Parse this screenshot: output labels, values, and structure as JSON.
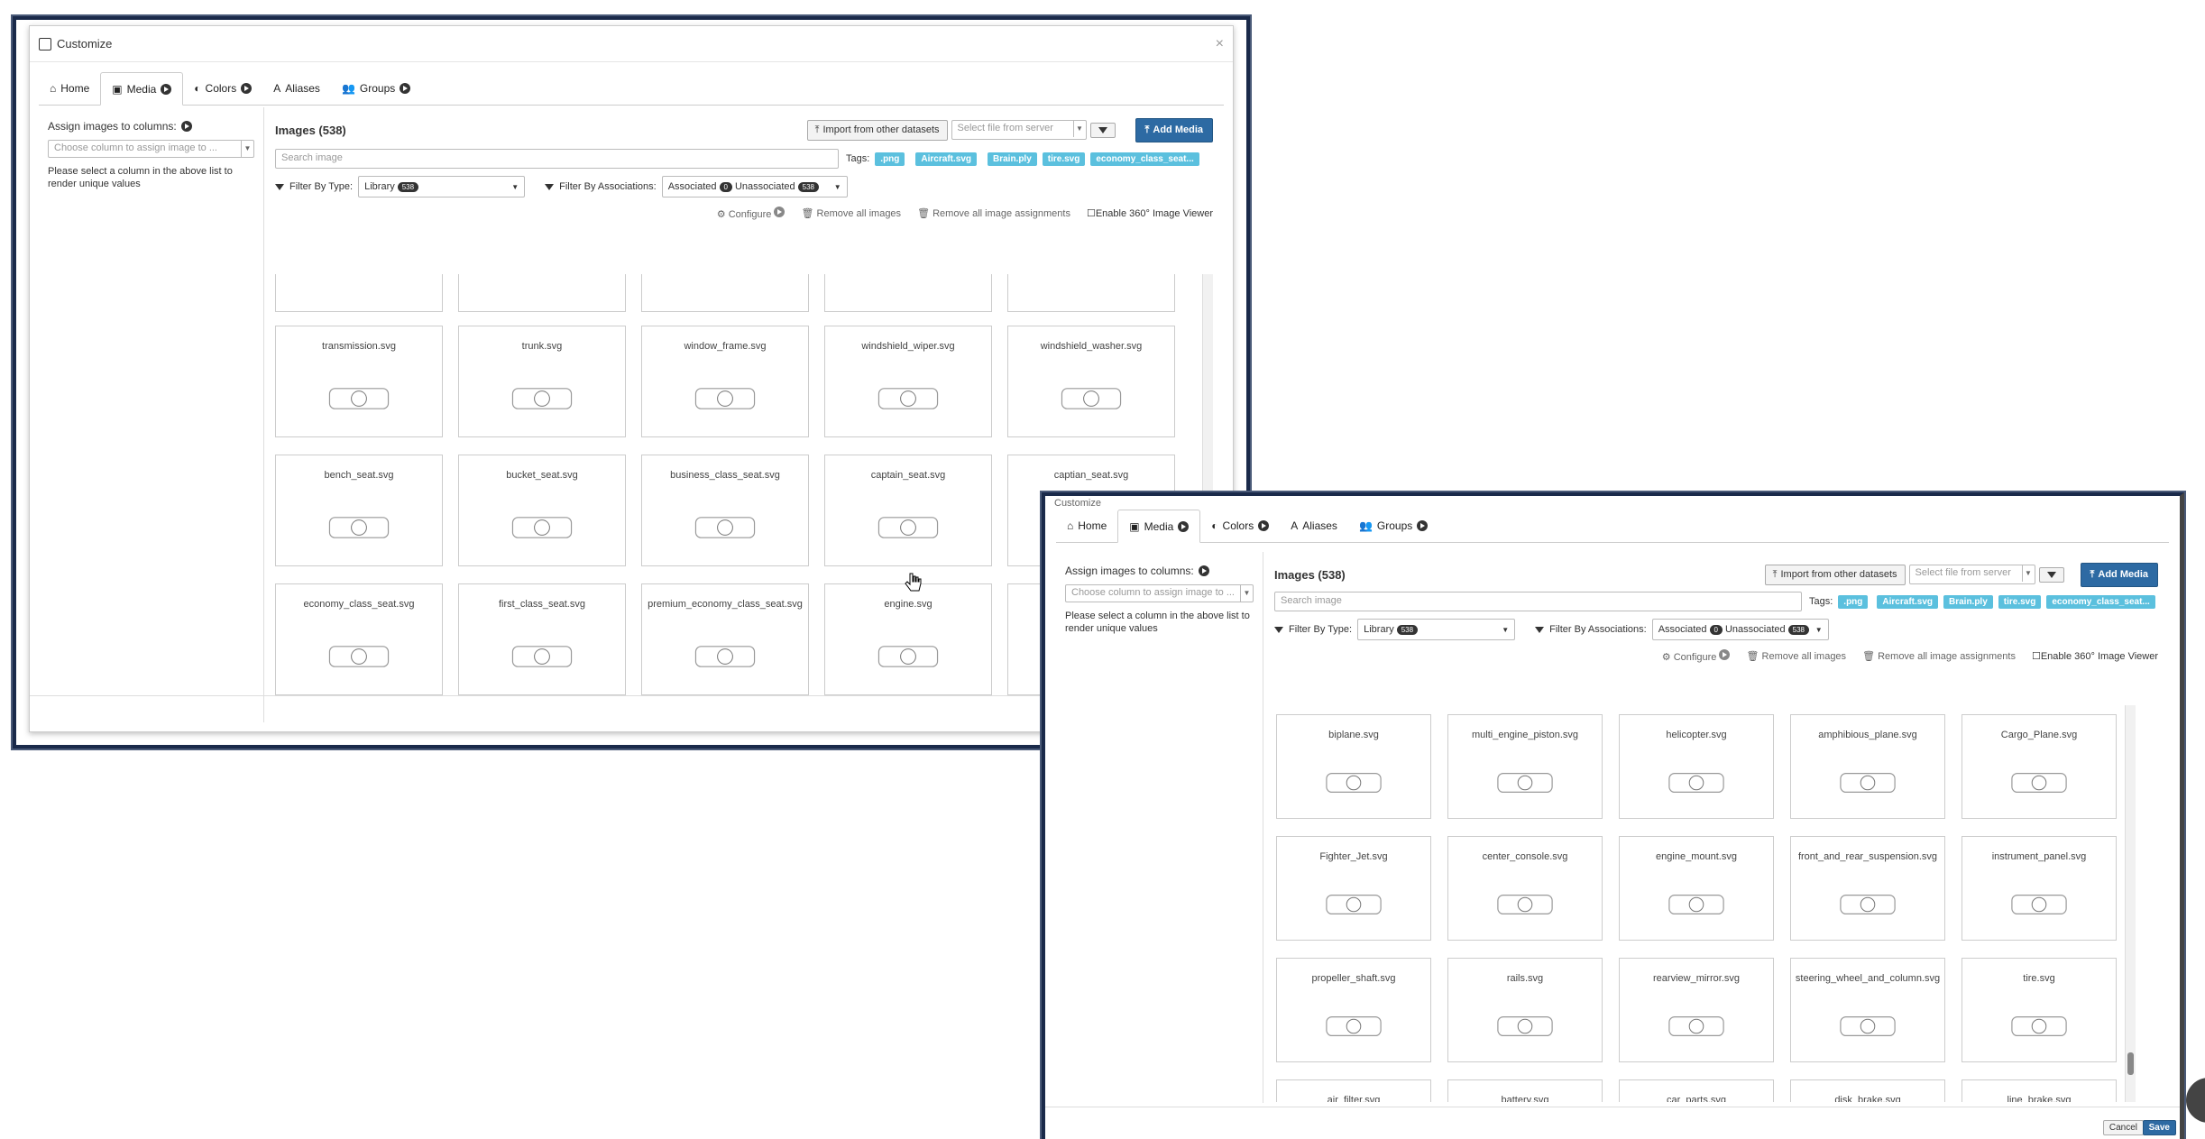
{
  "dialog": {
    "title": "Customize",
    "close": "×"
  },
  "tabs": [
    {
      "label": "Home",
      "icon": "home-icon",
      "dot": false
    },
    {
      "label": "Media",
      "icon": "image-icon",
      "dot": true
    },
    {
      "label": "Colors",
      "icon": "contrast-icon",
      "dot": true
    },
    {
      "label": "Aliases",
      "icon": "font-icon",
      "dot": false
    },
    {
      "label": "Groups",
      "icon": "users-icon",
      "dot": true
    }
  ],
  "left": {
    "assign_label": "Assign images to columns:",
    "column_placeholder": "Choose column to assign image to ...",
    "hint": "Please select a column in the above list to render unique values"
  },
  "media": {
    "images_title": "Images (538)",
    "import_label": "Import from other datasets",
    "server_placeholder": "Select file from server",
    "add_media": "Add Media",
    "search_placeholder": "Search image",
    "tags_label": "Tags:",
    "tags": [
      ".png",
      "Aircraft.svg",
      "Brain.ply",
      "tire.svg",
      "economy_class_seat..."
    ],
    "filter_type_label": "Filter By Type:",
    "filter_type_value": "Library",
    "filter_type_count": "538",
    "filter_assoc_label": "Filter By Associations:",
    "assoc_label": "Associated",
    "assoc_count": "0",
    "unassoc_label": "Unassociated",
    "unassoc_count": "538",
    "configure": "Configure",
    "remove_all": "Remove all images",
    "remove_assign": "Remove all image assignments",
    "enable_360": "Enable 360° Image Viewer"
  },
  "win1_cards": [
    [
      "transmission.svg",
      "trunk.svg",
      "window_frame.svg",
      "windshield_wiper.svg",
      "windshield_washer.svg"
    ],
    [
      "bench_seat.svg",
      "bucket_seat.svg",
      "business_class_seat.svg",
      "captain_seat.svg",
      "captian_seat.svg"
    ],
    [
      "economy_class_seat.svg",
      "first_class_seat.svg",
      "premium_economy_class_seat.svg",
      "engine.svg",
      ""
    ]
  ],
  "win2_cards": [
    [
      "biplane.svg",
      "multi_engine_piston.svg",
      "helicopter.svg",
      "amphibious_plane.svg",
      "Cargo_Plane.svg"
    ],
    [
      "Fighter_Jet.svg",
      "center_console.svg",
      "engine_mount.svg",
      "front_and_rear_suspension.svg",
      "instrument_panel.svg"
    ],
    [
      "propeller_shaft.svg",
      "rails.svg",
      "rearview_mirror.svg",
      "steering_wheel_and_column.svg",
      "tire.svg"
    ],
    [
      "air_filter.svg",
      "battery.svg",
      "car_parts.svg",
      "disk_brake.svg",
      "line_brake.svg"
    ]
  ],
  "footer": {
    "cancel": "Cancel",
    "save": "Save"
  }
}
